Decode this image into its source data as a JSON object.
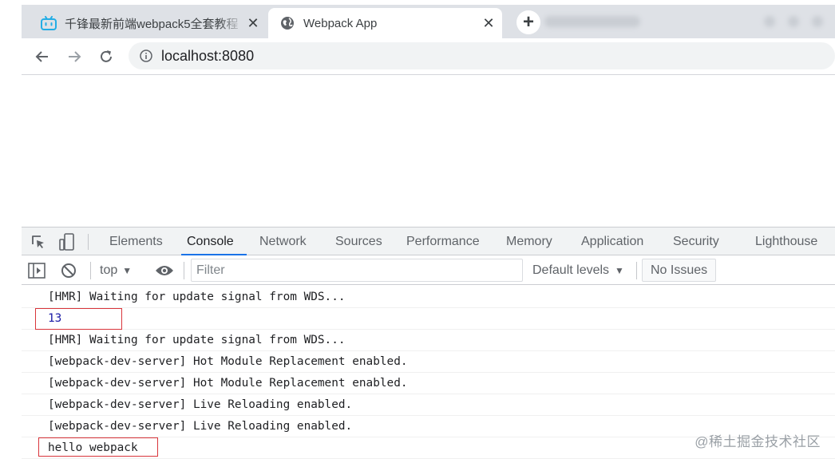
{
  "browser": {
    "tabs": [
      {
        "title": "千锋最新前端webpack5全套教程",
        "favicon": "bilibili-icon",
        "active": false,
        "close": "✕"
      },
      {
        "title": "Webpack App",
        "favicon": "globe-icon",
        "active": true,
        "close": "✕"
      }
    ],
    "new_tab": "+",
    "address": {
      "url": "localhost:8080"
    }
  },
  "devtools": {
    "tabs": [
      "Elements",
      "Console",
      "Network",
      "Sources",
      "Performance",
      "Memory",
      "Application",
      "Security",
      "Lighthouse"
    ],
    "selected_tab": "Console",
    "console_bar": {
      "context": "top",
      "filter_placeholder": "Filter",
      "levels": "Default levels",
      "issues": "No Issues"
    },
    "messages": [
      {
        "text": "[HMR] Waiting for update signal from WDS...",
        "kind": "text",
        "highlighted": false
      },
      {
        "text": "13",
        "kind": "number",
        "highlighted": true
      },
      {
        "text": "[HMR] Waiting for update signal from WDS...",
        "kind": "text",
        "highlighted": false
      },
      {
        "text": "[webpack-dev-server] Hot Module Replacement enabled.",
        "kind": "text",
        "highlighted": false
      },
      {
        "text": "[webpack-dev-server] Hot Module Replacement enabled.",
        "kind": "text",
        "highlighted": false
      },
      {
        "text": "[webpack-dev-server] Live Reloading enabled.",
        "kind": "text",
        "highlighted": false
      },
      {
        "text": "[webpack-dev-server] Live Reloading enabled.",
        "kind": "text",
        "highlighted": false
      },
      {
        "text": "hello webpack",
        "kind": "text",
        "highlighted": true
      }
    ]
  },
  "watermark": "@稀土掘金技术社区",
  "colors": {
    "accent": "#1a73e8",
    "highlight": "#d9353b",
    "number": "#1a1aa6"
  }
}
